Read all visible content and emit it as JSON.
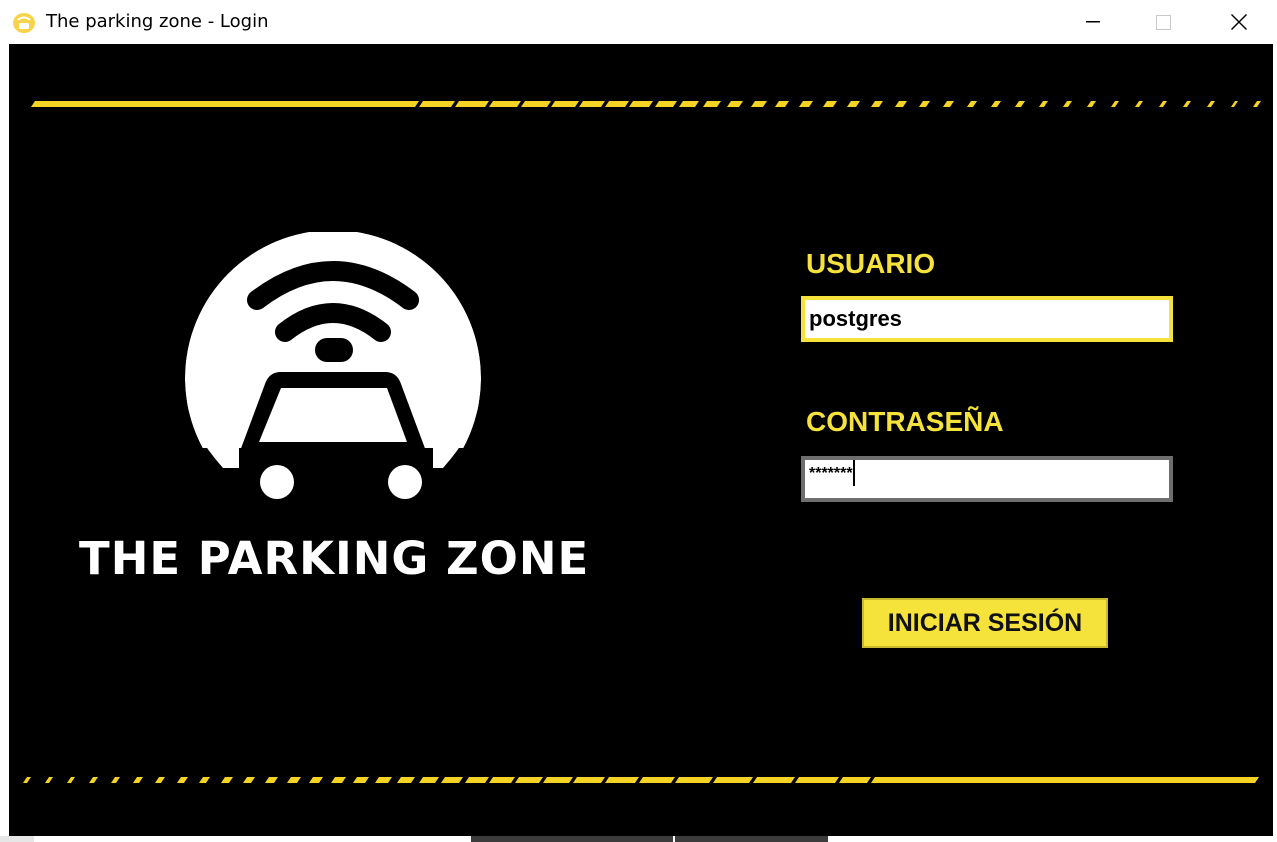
{
  "window": {
    "title": "The parking zone - Login",
    "icon": "parking-zone-app-icon"
  },
  "brand": {
    "name": "THE PARKING ZONE",
    "logo": "car-signal-logo"
  },
  "login_form": {
    "user_label": "USUARIO",
    "user_value": "postgres",
    "password_label": "CONTRASEÑA",
    "password_value": "*******",
    "submit_label": "INICIAR SESIÓN"
  },
  "colors": {
    "accent": "#f5e23a",
    "background": "#000000",
    "logo": "#ffffff"
  }
}
